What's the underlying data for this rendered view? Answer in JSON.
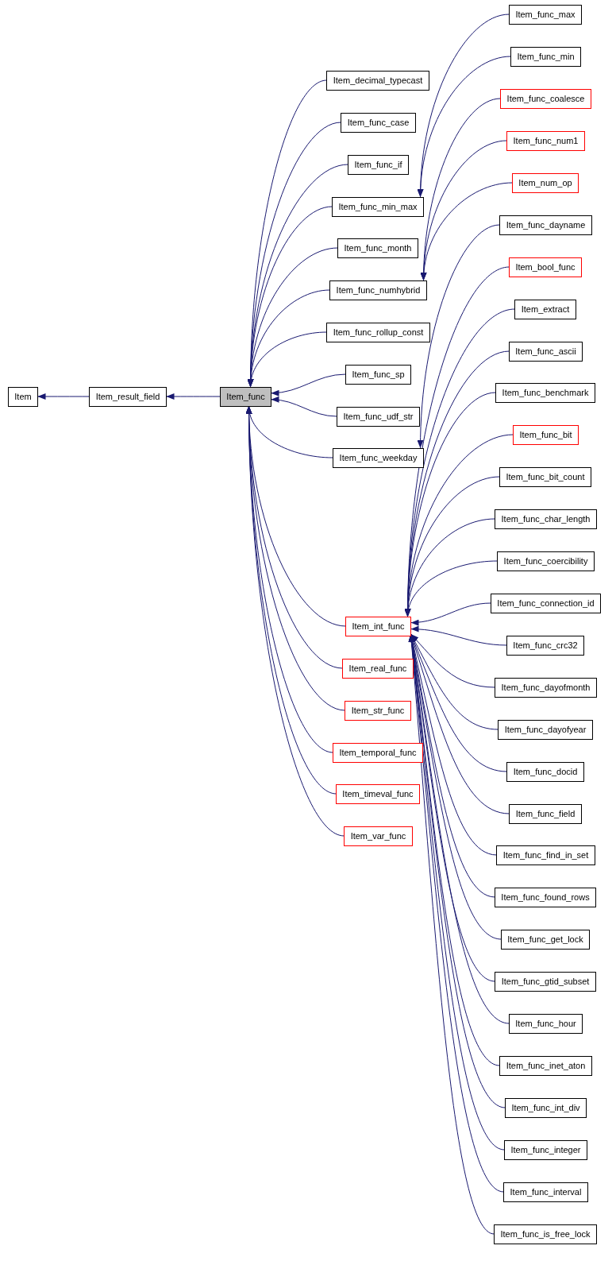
{
  "graph": {
    "label": "Item",
    "color": "#000000",
    "highlighted": false,
    "children": [
      {
        "label": "Item_result_field",
        "color": "#000000",
        "highlighted": false,
        "children": [
          {
            "label": "Item_func",
            "color": "#000000",
            "highlighted": true,
            "children": [
              {
                "label": "Item_decimal_typecast",
                "color": "#000000",
                "highlighted": false
              },
              {
                "label": "Item_func_case",
                "color": "#000000",
                "highlighted": false
              },
              {
                "label": "Item_func_if",
                "color": "#000000",
                "highlighted": false
              },
              {
                "label": "Item_func_min_max",
                "color": "#000000",
                "highlighted": false,
                "children": [
                  {
                    "label": "Item_func_max",
                    "color": "#000000",
                    "highlighted": false
                  },
                  {
                    "label": "Item_func_min",
                    "color": "#000000",
                    "highlighted": false
                  }
                ]
              },
              {
                "label": "Item_func_month",
                "color": "#000000",
                "highlighted": false
              },
              {
                "label": "Item_func_numhybrid",
                "color": "#000000",
                "highlighted": false,
                "children": [
                  {
                    "label": "Item_func_coalesce",
                    "color": "#ff0000",
                    "highlighted": false
                  },
                  {
                    "label": "Item_func_num1",
                    "color": "#ff0000",
                    "highlighted": false
                  },
                  {
                    "label": "Item_num_op",
                    "color": "#ff0000",
                    "highlighted": false
                  }
                ]
              },
              {
                "label": "Item_func_rollup_const",
                "color": "#000000",
                "highlighted": false
              },
              {
                "label": "Item_func_sp",
                "color": "#000000",
                "highlighted": false
              },
              {
                "label": "Item_func_udf_str",
                "color": "#000000",
                "highlighted": false
              },
              {
                "label": "Item_func_weekday",
                "color": "#000000",
                "highlighted": false,
                "children": [
                  {
                    "label": "Item_func_dayname",
                    "color": "#000000",
                    "highlighted": false
                  }
                ]
              },
              {
                "label": "Item_int_func",
                "color": "#ff0000",
                "highlighted": false,
                "children": [
                  {
                    "label": "Item_bool_func",
                    "color": "#ff0000",
                    "highlighted": false
                  },
                  {
                    "label": "Item_extract",
                    "color": "#000000",
                    "highlighted": false
                  },
                  {
                    "label": "Item_func_ascii",
                    "color": "#000000",
                    "highlighted": false
                  },
                  {
                    "label": "Item_func_benchmark",
                    "color": "#000000",
                    "highlighted": false
                  },
                  {
                    "label": "Item_func_bit",
                    "color": "#ff0000",
                    "highlighted": false
                  },
                  {
                    "label": "Item_func_bit_count",
                    "color": "#000000",
                    "highlighted": false
                  },
                  {
                    "label": "Item_func_char_length",
                    "color": "#000000",
                    "highlighted": false
                  },
                  {
                    "label": "Item_func_coercibility",
                    "color": "#000000",
                    "highlighted": false
                  },
                  {
                    "label": "Item_func_connection_id",
                    "color": "#000000",
                    "highlighted": false
                  },
                  {
                    "label": "Item_func_crc32",
                    "color": "#000000",
                    "highlighted": false
                  },
                  {
                    "label": "Item_func_dayofmonth",
                    "color": "#000000",
                    "highlighted": false
                  },
                  {
                    "label": "Item_func_dayofyear",
                    "color": "#000000",
                    "highlighted": false
                  },
                  {
                    "label": "Item_func_docid",
                    "color": "#000000",
                    "highlighted": false
                  },
                  {
                    "label": "Item_func_field",
                    "color": "#000000",
                    "highlighted": false
                  },
                  {
                    "label": "Item_func_find_in_set",
                    "color": "#000000",
                    "highlighted": false
                  },
                  {
                    "label": "Item_func_found_rows",
                    "color": "#000000",
                    "highlighted": false
                  },
                  {
                    "label": "Item_func_get_lock",
                    "color": "#000000",
                    "highlighted": false
                  },
                  {
                    "label": "Item_func_gtid_subset",
                    "color": "#000000",
                    "highlighted": false
                  },
                  {
                    "label": "Item_func_hour",
                    "color": "#000000",
                    "highlighted": false
                  },
                  {
                    "label": "Item_func_inet_aton",
                    "color": "#000000",
                    "highlighted": false
                  },
                  {
                    "label": "Item_func_int_div",
                    "color": "#000000",
                    "highlighted": false
                  },
                  {
                    "label": "Item_func_integer",
                    "color": "#000000",
                    "highlighted": false
                  },
                  {
                    "label": "Item_func_interval",
                    "color": "#000000",
                    "highlighted": false
                  },
                  {
                    "label": "Item_func_is_free_lock",
                    "color": "#000000",
                    "highlighted": false
                  }
                ]
              },
              {
                "label": "Item_real_func",
                "color": "#ff0000",
                "highlighted": false
              },
              {
                "label": "Item_str_func",
                "color": "#ff0000",
                "highlighted": false
              },
              {
                "label": "Item_temporal_func",
                "color": "#ff0000",
                "highlighted": false
              },
              {
                "label": "Item_timeval_func",
                "color": "#ff0000",
                "highlighted": false
              },
              {
                "label": "Item_var_func",
                "color": "#ff0000",
                "highlighted": false
              }
            ]
          }
        ]
      }
    ]
  }
}
